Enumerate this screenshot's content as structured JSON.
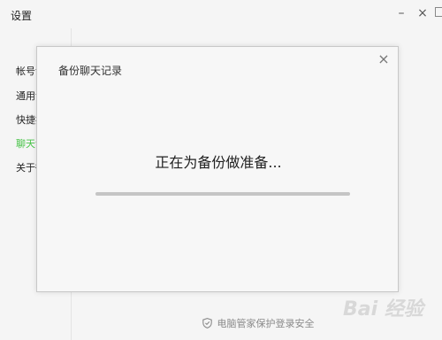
{
  "window": {
    "title": "设置",
    "minimize_glyph": "–",
    "close_glyph": "×"
  },
  "sidebar": {
    "items": [
      {
        "label": "帐号设置",
        "active": false
      },
      {
        "label": "通用设置",
        "active": false
      },
      {
        "label": "快捷按键",
        "active": false
      },
      {
        "label": "聊天记录",
        "active": true
      },
      {
        "label": "关于微信",
        "active": false
      }
    ]
  },
  "footer": {
    "note": "电脑管家保护登录安全",
    "icon": "shield-icon"
  },
  "watermark": {
    "text": "Bai 经验"
  },
  "dialog": {
    "title": "备份聊天记录",
    "close_glyph": "×",
    "status": "正在为备份做准备...",
    "progress": 0.0
  },
  "colors": {
    "accent_green": "#46c346",
    "progress_track": "#c5c5c5"
  }
}
